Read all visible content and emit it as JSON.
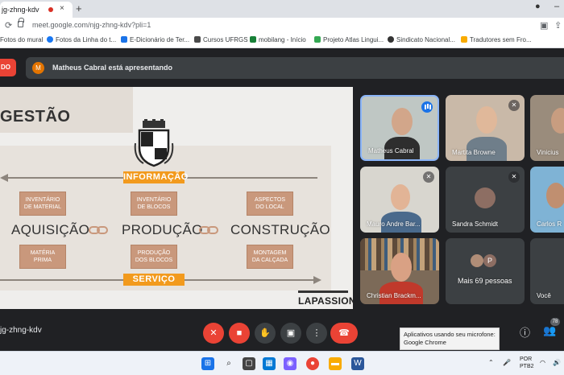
{
  "browser": {
    "tab_title": "jg-zhng-kdv",
    "tab_close": "×",
    "new_tab": "+",
    "url": "meet.google.com/njg-zhng-kdv?pli=1",
    "bookmarks": [
      {
        "label": "Fotos do mural",
        "color": "#8ab4f8"
      },
      {
        "label": "Fotos da Linha do t...",
        "color": "#1877f2"
      },
      {
        "label": "E-Dicionário de Ter...",
        "color": "#1a73e8"
      },
      {
        "label": "Cursos UFRGS",
        "color": "#4a4a4a"
      },
      {
        "label": "mobilang - Início",
        "color": "#188038"
      },
      {
        "label": "Projeto Atlas Lingui...",
        "color": "#34a853"
      },
      {
        "label": "Sindicato Nacional...",
        "color": "#333333"
      },
      {
        "label": "Tradutores sem Fro...",
        "color": "#f9ab00"
      }
    ]
  },
  "meet": {
    "recording_badge": "DO",
    "presenting_initial": "M",
    "presenting_text": "Matheus Cabral está apresentando",
    "meeting_code": "jg-zhng-kdv",
    "participants_count": "78",
    "tooltip_line1": "Aplicativos usando seu microfone:",
    "tooltip_line2": "Google Chrome"
  },
  "slide": {
    "title": "GESTÃO",
    "informacao": "INFORMAÇÃO",
    "servico": "SERVIÇO",
    "col1_top_1": "INVENTÁRIO",
    "col1_top_2": "DE MATERIAL",
    "col2_top_1": "INVENTÁRIO",
    "col2_top_2": "DE BLOCOS",
    "col3_top_1": "ASPECTOS",
    "col3_top_2": "DO LOCAL",
    "aquisicao": "AQUISIÇÃO",
    "producao": "PRODUÇÃO",
    "construcao": "CONSTRUÇÃO",
    "col1_bot_1": "MATÉRIA",
    "col1_bot_2": "PRIMA",
    "col2_bot_1": "PRODUÇÃO",
    "col2_bot_2": "DOS BLOCOS",
    "col3_bot_1": "MONTAGEM",
    "col3_bot_2": "DA CALÇADA",
    "brand": "LAPASSION"
  },
  "participants": [
    {
      "name": "Matheus Cabral"
    },
    {
      "name": "Martita Browne"
    },
    {
      "name": "Vinicius"
    },
    {
      "name": "Mauro Andre Bar..."
    },
    {
      "name": "Sandra Schmidt"
    },
    {
      "name": "Carlos R"
    },
    {
      "name": "Christian Brackm..."
    },
    {
      "name": "Mais 69 pessoas",
      "avatar": "P"
    },
    {
      "name": "Você"
    }
  ],
  "taskbar": {
    "lang1": "POR",
    "lang2": "PTB2"
  }
}
